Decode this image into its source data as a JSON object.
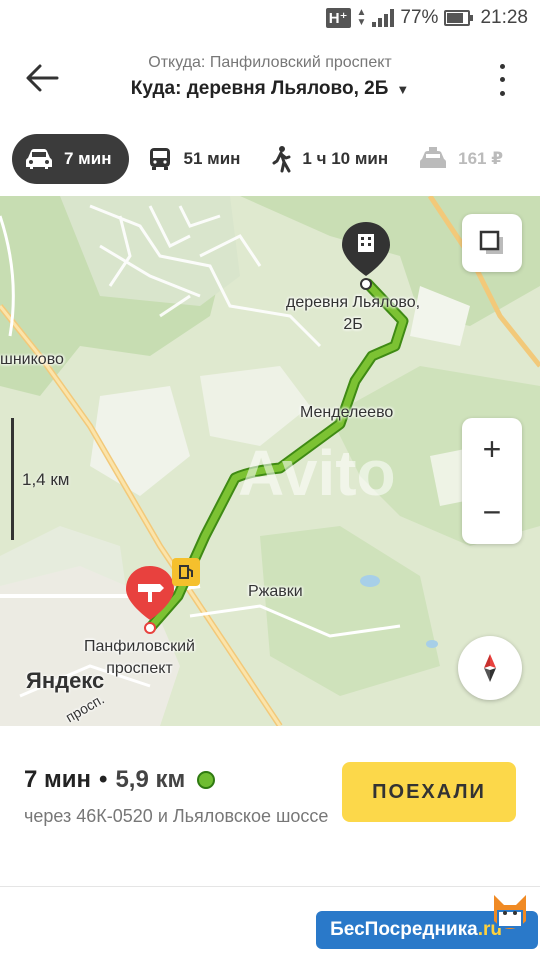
{
  "status_bar": {
    "network": "H⁺",
    "battery_percent": "77%",
    "battery_level": 0.77,
    "time": "21:28"
  },
  "header": {
    "from_label": "Откуда: Панфиловский проспект",
    "to_label": "Куда: деревня Льялово, 2Б"
  },
  "transport_tabs": [
    {
      "icon": "car-icon",
      "label": "7 мин",
      "active": true
    },
    {
      "icon": "bus-icon",
      "label": "51 мин",
      "active": false
    },
    {
      "icon": "pedestrian-icon",
      "label": "1 ч 10 мин",
      "active": false
    },
    {
      "icon": "taxi-icon",
      "label": "161 ₽",
      "active": false
    }
  ],
  "map": {
    "labels": {
      "destination_line1": "деревня Льялово,",
      "destination_line2": "2Б",
      "village_left": "шниково",
      "mendeleevo": "Менделеево",
      "rzhavki": "Ржавки",
      "start_line1": "Панфиловский",
      "start_line2": "проспект",
      "scale": "1,4 км",
      "yandex": "Яндекс",
      "road_label": "просп."
    },
    "watermark_text": "Avito",
    "zoom_in": "+",
    "zoom_out": "−",
    "colors": {
      "route": "#7cc233",
      "route_outline": "#3f8a14",
      "start_pin": "#e8413e",
      "dest_pin": "#333333"
    }
  },
  "route_panel": {
    "time": "7 мин",
    "separator": "•",
    "distance": "5,9 км",
    "via": "через 46К-0520 и Льяловское шоссе",
    "go_button": "ПОЕХАЛИ",
    "go_button_color": "#fcd84a"
  },
  "watermark": {
    "text": "БесПосредника",
    "suffix": ".ru"
  }
}
